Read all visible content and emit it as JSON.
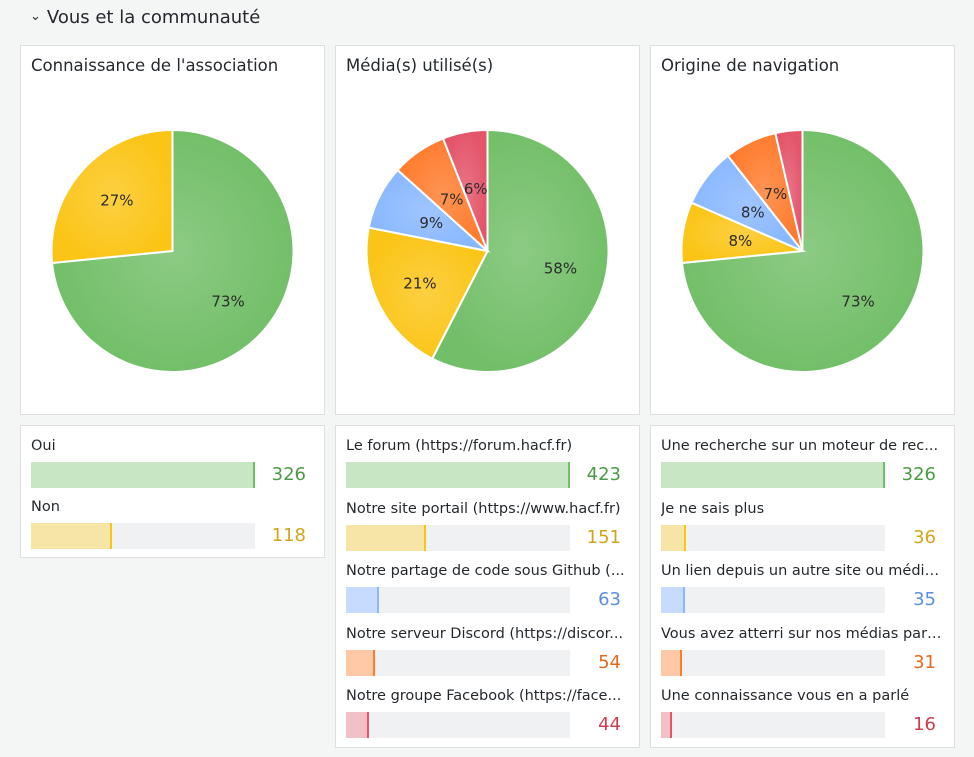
{
  "section": {
    "title": "Vous et la communauté"
  },
  "colors": {
    "green": "#73bf69",
    "yellow": "#fbc518",
    "blue": "#8ab8ff",
    "orange": "#ff7c2e",
    "red": "#e4556a"
  },
  "chart_data": [
    {
      "type": "pie",
      "title": "Connaissance de l'association",
      "slices": [
        {
          "label": "Oui",
          "value": 326,
          "percent": "73%",
          "color": "#73bf69"
        },
        {
          "label": "Non",
          "value": 118,
          "percent": "27%",
          "color": "#fbc518"
        }
      ]
    },
    {
      "type": "pie",
      "title": "Média(s) utilisé(s)",
      "slices": [
        {
          "label": "Le forum (https://forum.hacf.fr)",
          "value": 423,
          "percent": "58%",
          "color": "#73bf69"
        },
        {
          "label": "Notre site portail (https://www.hacf.fr)",
          "value": 151,
          "percent": "21%",
          "color": "#fbc518"
        },
        {
          "label": "Notre partage de code sous Github (...",
          "value": 63,
          "percent": "9%",
          "color": "#8ab8ff"
        },
        {
          "label": "Notre serveur Discord (https://discor...",
          "value": 54,
          "percent": "7%",
          "color": "#ff7c2e"
        },
        {
          "label": "Notre groupe Facebook (https://face...",
          "value": 44,
          "percent": "6%",
          "color": "#e4556a"
        }
      ]
    },
    {
      "type": "pie",
      "title": "Origine de navigation",
      "slices": [
        {
          "label": "Une recherche sur un moteur de rec...",
          "value": 326,
          "percent": "73%",
          "color": "#73bf69"
        },
        {
          "label": "Je ne sais plus",
          "value": 36,
          "percent": "8%",
          "color": "#fbc518"
        },
        {
          "label": "Un lien depuis un autre site ou média...",
          "value": 35,
          "percent": "8%",
          "color": "#8ab8ff"
        },
        {
          "label": "Vous avez atterri sur nos médias par ...",
          "value": 31,
          "percent": "7%",
          "color": "#ff7c2e"
        },
        {
          "label": "Une connaissance vous en a parlé",
          "value": 16,
          "percent": "",
          "color": "#e4556a"
        }
      ]
    }
  ]
}
